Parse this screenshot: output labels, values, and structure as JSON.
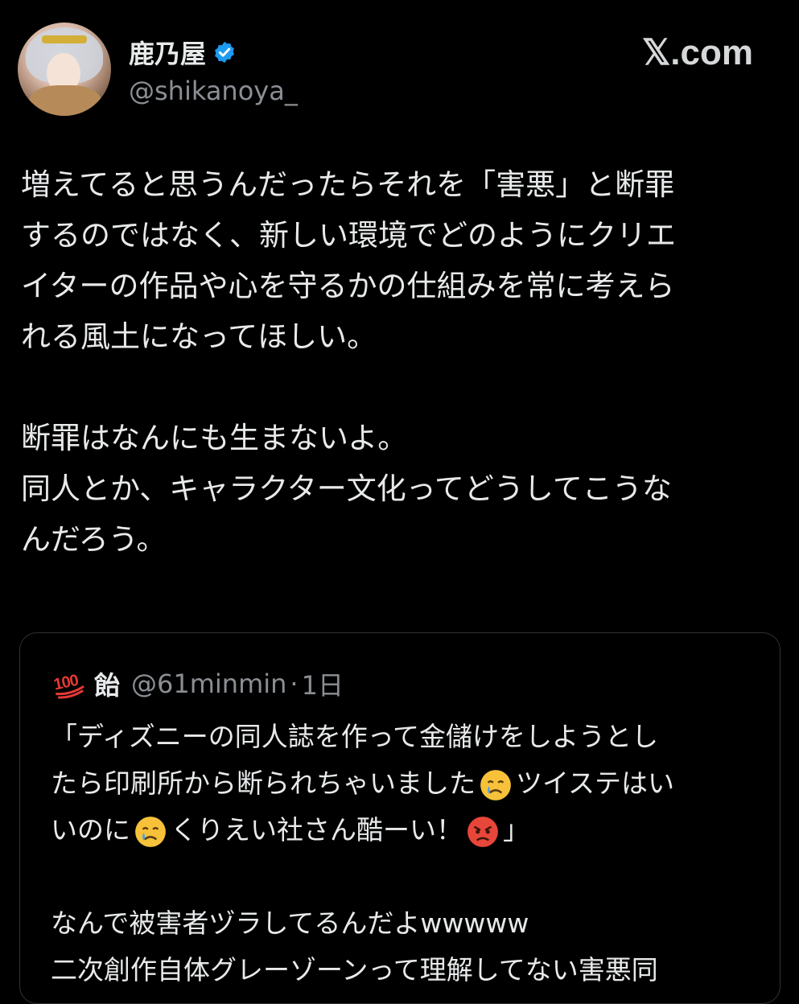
{
  "author": {
    "display_name": "鹿乃屋",
    "handle": "@shikanoya_",
    "verified": true
  },
  "site_logo": "𝕏.com",
  "tweet": {
    "paragraph1": [
      "増えてると思うんだったらそれを「害悪」と断罪",
      "するのではなく、新しい環境でどのようにクリエ",
      "イターの作品や心を守るかの仕組みを常に考えら",
      "れる風土になってほしい。"
    ],
    "paragraph2": [
      "断罪はなんにも生まないよ。",
      "同人とか、キャラクター文化ってどうしてこうな",
      "んだろう。"
    ]
  },
  "quote": {
    "badge_icon": "hundred-points-emoji",
    "name": "飴",
    "handle": "@61minmin",
    "separator": "·",
    "time": "1日",
    "line1": "「ディズニーの同人誌を作って金儲けをしようとし",
    "line2_a": "たら印刷所から断られちゃいました",
    "line2_b": "ツイステはい",
    "line3_a": "いのに",
    "line3_b": "くりえい社さん酷ーい！",
    "line3_c": "」",
    "line4": "なんで被害者ヅラしてるんだよwwwww",
    "line5": "二次創作自体グレーゾーンって理解してない害悪同",
    "emoji_cry": "crying-face-emoji",
    "emoji_angry": "angry-face-emoji"
  },
  "colors": {
    "background": "#000000",
    "text": "#e7e9ea",
    "secondary": "#8b8f94",
    "verified": "#1d9bf0",
    "border": "#2f3336"
  }
}
